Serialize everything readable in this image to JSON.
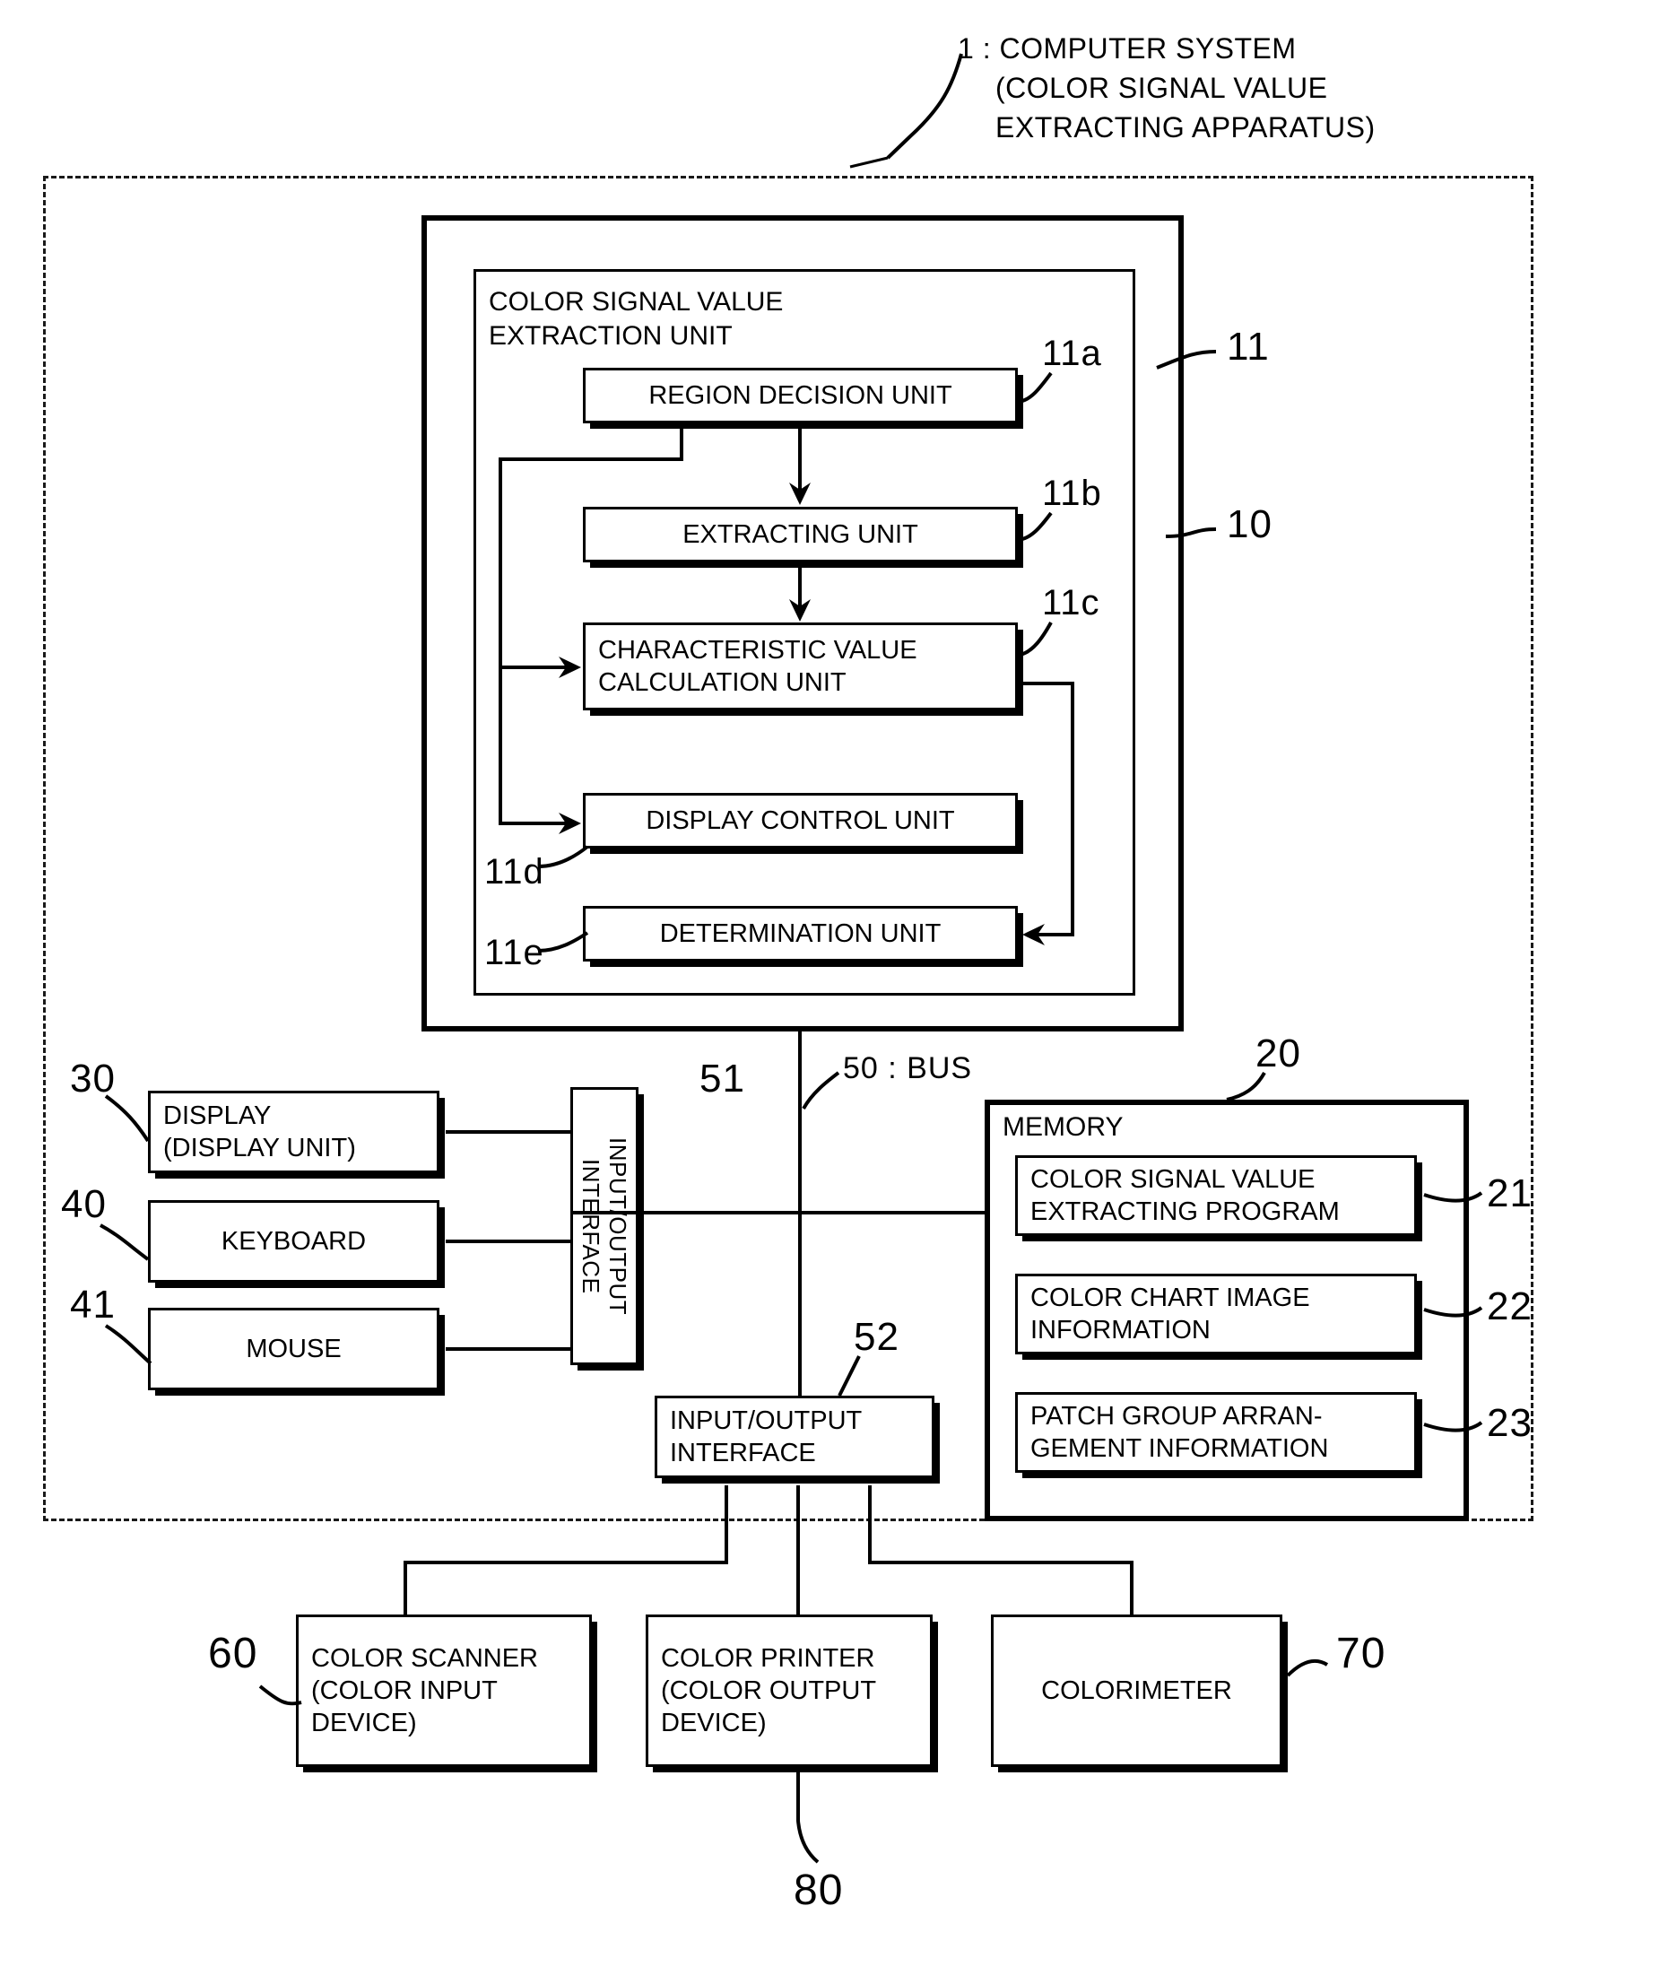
{
  "figure": {
    "title_lines": [
      "1 : COMPUTER SYSTEM",
      "(COLOR SIGNAL VALUE",
      "EXTRACTING APPARATUS)"
    ],
    "title_line1": "1 : COMPUTER SYSTEM",
    "title_line2": "(COLOR SIGNAL VALUE",
    "title_line3": "EXTRACTING APPARATUS)"
  },
  "cpu": {
    "ref": "10",
    "extraction_unit": {
      "ref": "11",
      "label": "COLOR SIGNAL VALUE\nEXTRACTION UNIT",
      "sub_units": [
        {
          "ref": "11a",
          "label": "REGION DECISION UNIT"
        },
        {
          "ref": "11b",
          "label": "EXTRACTING UNIT"
        },
        {
          "ref": "11c",
          "label": "CHARACTERISTIC VALUE\nCALCULATION UNIT"
        },
        {
          "ref": "11d",
          "label": "DISPLAY CONTROL UNIT"
        },
        {
          "ref": "11e",
          "label": "DETERMINATION UNIT"
        }
      ]
    }
  },
  "bus": {
    "label": "50 : BUS"
  },
  "peripherals": [
    {
      "ref": "30",
      "label": "DISPLAY\n(DISPLAY UNIT)"
    },
    {
      "ref": "40",
      "label": "KEYBOARD"
    },
    {
      "ref": "41",
      "label": "MOUSE"
    }
  ],
  "interfaces": [
    {
      "ref": "51",
      "label": "INPUT/OUTPUT\nINTERFACE"
    },
    {
      "ref": "52",
      "label": "INPUT/OUTPUT\nINTERFACE"
    }
  ],
  "memory": {
    "ref": "20",
    "label": "MEMORY",
    "items": [
      {
        "ref": "21",
        "label": "COLOR SIGNAL VALUE\nEXTRACTING PROGRAM"
      },
      {
        "ref": "22",
        "label": "COLOR CHART IMAGE\nINFORMATION"
      },
      {
        "ref": "23",
        "label": "PATCH GROUP ARRAN-\nGEMENT INFORMATION"
      }
    ]
  },
  "devices": [
    {
      "ref": "60",
      "label": "COLOR SCANNER\n(COLOR INPUT\nDEVICE)"
    },
    {
      "ref": "80",
      "label": "COLOR PRINTER\n(COLOR OUTPUT\nDEVICE)"
    },
    {
      "ref": "70",
      "label": "COLORIMETER"
    }
  ],
  "device_refs": {
    "scanner": "60",
    "printer": "80",
    "colorimeter": "70"
  },
  "colors": {
    "ink": "#000000",
    "paper": "#ffffff"
  }
}
